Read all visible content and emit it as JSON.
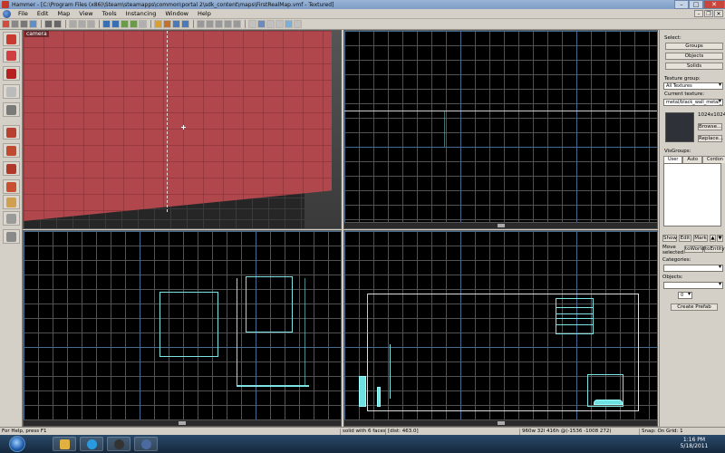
{
  "window": {
    "title": "Hammer - [C:\\Program Files (x86)\\Steam\\steamapps\\common\\portal 2\\sdk_content\\maps\\FirstRealMap.vmf - Textured]",
    "minimize": "–",
    "maximize": "□",
    "close": "✕"
  },
  "menu": {
    "items": [
      "File",
      "Edit",
      "Map",
      "View",
      "Tools",
      "Instancing",
      "Window",
      "Help"
    ],
    "mdi_minimize": "–",
    "mdi_restore": "❐",
    "mdi_close": "✕"
  },
  "viewports": {
    "camera_label": "camera"
  },
  "right_panel": {
    "select_label": "Select:",
    "groups_button": "Groups",
    "objects_button": "Objects",
    "solids_button": "Solids",
    "texture_group_label": "Texture group:",
    "texture_group_value": "All Textures",
    "current_texture_label": "Current texture:",
    "current_texture_value": "metal/black_wall_metal_",
    "texture_size": "1024x1024",
    "browse_button": "Browse...",
    "replace_button": "Replace...",
    "visgroups_label": "VisGroups:",
    "tab_user": "User",
    "tab_auto": "Auto",
    "tab_cordon": "Cordon",
    "show_button": "Show",
    "edit_button": "Edit",
    "mark_button": "Mark",
    "move_selected_label": "Move selected:",
    "to_world_button": "toWorld",
    "to_entity_button": "toEntity",
    "categories_label": "Categories:",
    "objects_label": "Objects:",
    "prefab_count": "0",
    "create_prefab_button": "Create Prefab"
  },
  "statusbar": {
    "help": "For Help, press F1",
    "selection": "solid with 6 faces",
    "dist": "[dist: 463.0]",
    "size": "960w 32l 416h @(-1536 -1008 272)",
    "snap": "Snap: On Grid: 1"
  },
  "taskbar": {
    "time": "1:16 PM",
    "date": "5/18/2011"
  },
  "colors": {
    "brush_wireframe": "#7fe3e3",
    "wall_texture": "#b0474c",
    "titlebar": "#8aa6cc"
  }
}
